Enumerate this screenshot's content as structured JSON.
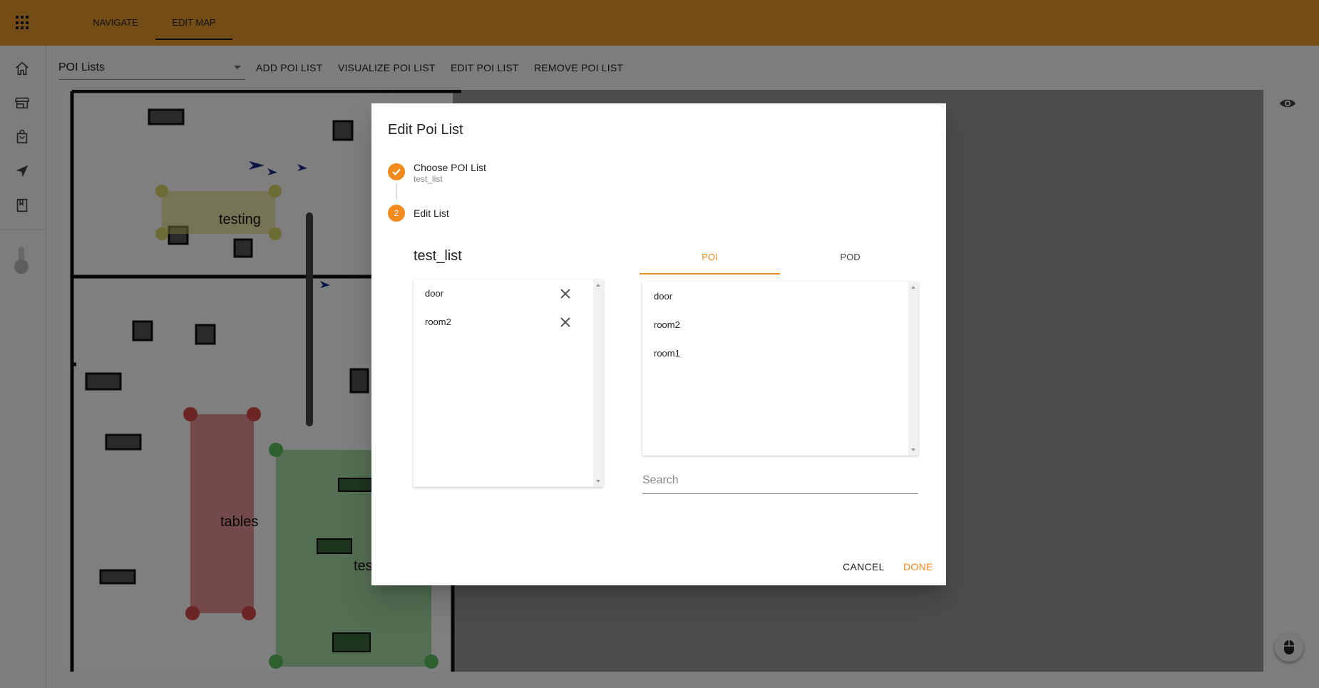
{
  "topbar": {
    "apps_icon": "apps-grid-icon",
    "tabs": [
      {
        "label": "NAVIGATE"
      },
      {
        "label": "EDIT MAP",
        "active": true
      }
    ],
    "color": "#e89a2c"
  },
  "sidebar": {
    "items": [
      {
        "icon": "home-icon"
      },
      {
        "icon": "store-icon"
      },
      {
        "icon": "shopping-bag-icon"
      },
      {
        "icon": "navigation-arrow-icon"
      },
      {
        "icon": "book-icon"
      }
    ]
  },
  "toolbar": {
    "select_value": "POI Lists",
    "buttons": [
      "ADD POI LIST",
      "VISUALIZE POI LIST",
      "EDIT POI LIST",
      "REMOVE POI LIST"
    ]
  },
  "map": {
    "labels": [
      "testing",
      "tables",
      "tes"
    ],
    "zone_colors": {
      "yellow": "#d9d96a",
      "red": "#d94a4a",
      "green": "#5cbf5c"
    }
  },
  "dialog": {
    "title": "Edit Poi List",
    "steps": [
      {
        "label": "Choose POI List",
        "sub": "test_list",
        "state": "done",
        "icon": "check-icon"
      },
      {
        "number": "2",
        "label": "Edit List",
        "state": "active"
      }
    ],
    "list_title": "test_list",
    "selected_items": [
      "door",
      "room2"
    ],
    "tabs": [
      {
        "label": "POI",
        "active": true
      },
      {
        "label": "POD",
        "active": false
      }
    ],
    "available_items": [
      "door",
      "room2",
      "room1"
    ],
    "search": {
      "placeholder": "Search",
      "value": ""
    },
    "cancel_label": "CANCEL",
    "done_label": "DONE",
    "accent": "#f28a1e"
  }
}
